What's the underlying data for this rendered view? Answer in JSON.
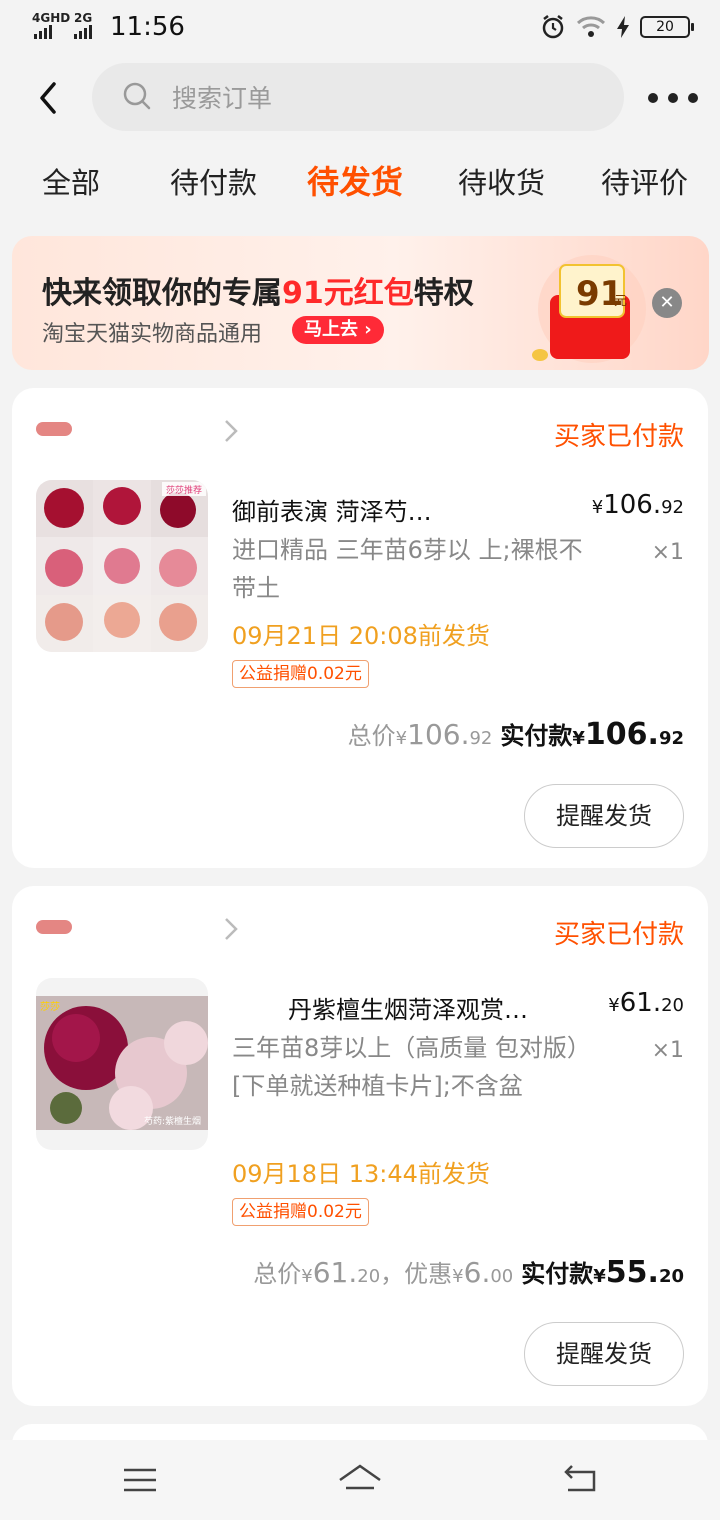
{
  "status_bar": {
    "net1": "4GHD",
    "net2": "2G",
    "time": "11:56",
    "battery": "20"
  },
  "search": {
    "placeholder": "搜索订单"
  },
  "tabs": [
    {
      "label": "全部"
    },
    {
      "label": "待付款"
    },
    {
      "label": "待发货",
      "active": true
    },
    {
      "label": "待收货"
    },
    {
      "label": "待评价"
    }
  ],
  "banner": {
    "title_prefix": "快来领取你的专属",
    "title_highlight": "91元红包",
    "title_suffix": "特权",
    "subtitle": "淘宝天猫实物商品通用",
    "cta": "马上去",
    "packet_amount": "91",
    "packet_unit": "元"
  },
  "orders": [
    {
      "status": "买家已付款",
      "title": "御前表演 菏泽芍…",
      "price_int": "106.",
      "price_dec": "92",
      "sku": "进口精品 三年苗6芽以 上;裸根不带土",
      "qty": "×1",
      "ship": "09月21日 20:08前发货",
      "charity": "公益捐赠0.02元",
      "total_label": "总价",
      "total_int": "106.",
      "total_dec": "92",
      "paid_label": "实付款",
      "paid_int": "106.",
      "paid_dec": "92",
      "remind": "提醒发货",
      "thumb_label": "莎莎推荐"
    },
    {
      "status": "买家已付款",
      "title": "丹紫檀生烟菏泽观赏…",
      "price_int": "61.",
      "price_dec": "20",
      "sku": "三年苗8芽以上（高质量 包对版）[下单就送种植卡片];不含盆",
      "qty": "×1",
      "ship": "09月18日 13:44前发货",
      "charity": "公益捐赠0.02元",
      "total_label": "总价",
      "total_int": "61.",
      "total_dec": "20",
      "discount_label": "，优惠",
      "discount_int": "6.",
      "discount_dec": "00",
      "paid_label": "实付款",
      "paid_int": "55.",
      "paid_dec": "20",
      "remind": "提醒发货",
      "thumb_label": "芍药:紫檀生烟"
    }
  ],
  "colors": {
    "accent": "#ff5000",
    "ship": "#f0a020",
    "banner_red": "#ff2a2a"
  }
}
